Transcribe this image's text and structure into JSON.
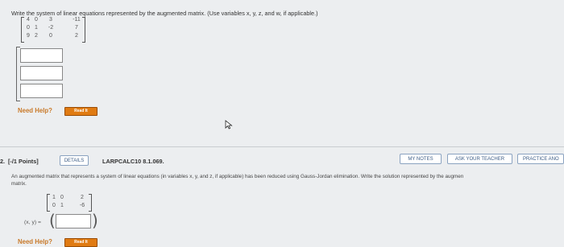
{
  "q1": {
    "prompt": "Write the system of linear equations represented by the augmented matrix. (Use variables x, y, z, and w, if applicable.)",
    "matrix": [
      [
        "4",
        "0",
        "3",
        "-11"
      ],
      [
        "0",
        "1",
        "-2",
        "7"
      ],
      [
        "9",
        "2",
        "0",
        "2"
      ]
    ],
    "need_help_label": "Need Help?",
    "read_it_label": "Read It"
  },
  "q2": {
    "number": "2.",
    "points": "[-/1 Points]",
    "details_label": "DETAILS",
    "code": "LARPCALC10 8.1.069.",
    "my_notes_label": "MY NOTES",
    "ask_teacher_label": "ASK YOUR TEACHER",
    "practice_label": "PRACTICE ANO",
    "prompt_line1": "An augmented matrix that represents a system of linear equations (in variables x, y, and z, if applicable) has been reduced using Gauss-Jordan elimination. Write the solution represented by the augmen",
    "prompt_line2": "matrix.",
    "matrix": [
      [
        "1",
        "0",
        "2"
      ],
      [
        "0",
        "1",
        "-6"
      ]
    ],
    "answer_label": "(x, y) =",
    "paren_open": "(",
    "paren_close": ")",
    "need_help_label": "Need Help?",
    "read_it_label": "Read It"
  },
  "colors": {
    "accent_orange": "#e07b12",
    "button_border": "#8aa2c0",
    "background": "#eceef0"
  },
  "icons": [
    "mouse-pointer-icon"
  ]
}
